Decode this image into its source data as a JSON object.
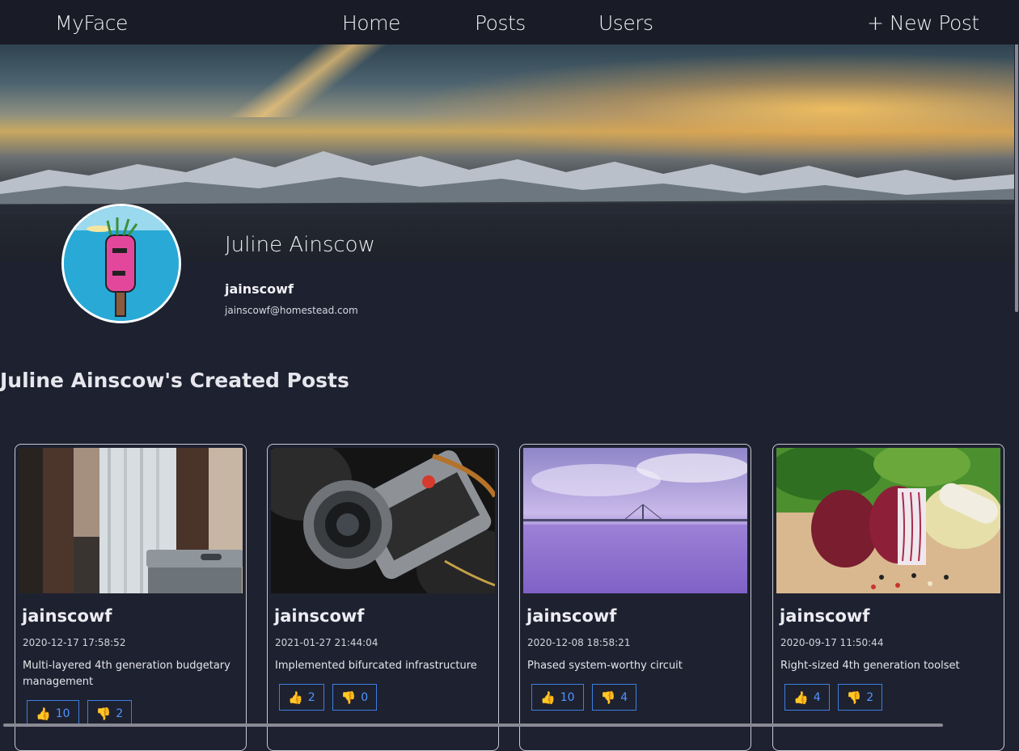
{
  "nav": {
    "brand": "MyFace",
    "links": [
      "Home",
      "Posts",
      "Users"
    ],
    "new_post": "+ New Post"
  },
  "profile": {
    "name": "Juline Ainscow",
    "username": "jainscowf",
    "email": "jainscowf@homestead.com"
  },
  "section_title": "Juline Ainscow's Created Posts",
  "posts": [
    {
      "author": "jainscowf",
      "date": "2020-12-17 17:58:52",
      "message": "Multi-layered 4th generation budgetary management",
      "likes": "10",
      "dislikes": "2",
      "image": "window-curtain-chair"
    },
    {
      "author": "jainscowf",
      "date": "2021-01-27 21:44:04",
      "message": "Implemented bifurcated infrastructure",
      "likes": "2",
      "dislikes": "0",
      "image": "camera"
    },
    {
      "author": "jainscowf",
      "date": "2020-12-08 18:58:21",
      "message": "Phased system-worthy circuit",
      "likes": "10",
      "dislikes": "4",
      "image": "bridge-over-purple-sea"
    },
    {
      "author": "jainscowf",
      "date": "2020-09-17 11:50:44",
      "message": "Right-sized 4th generation toolset",
      "likes": "4",
      "dislikes": "2",
      "image": "onions-and-vegetables"
    }
  ],
  "icons": {
    "like": "thumbs-up-icon",
    "dislike": "thumbs-down-icon"
  },
  "colors": {
    "background": "#1e2130",
    "navbar": "#191b26",
    "vote_border": "#3d7fe0",
    "vote_text": "#4f96ff",
    "thumb": "#f2b62b"
  }
}
